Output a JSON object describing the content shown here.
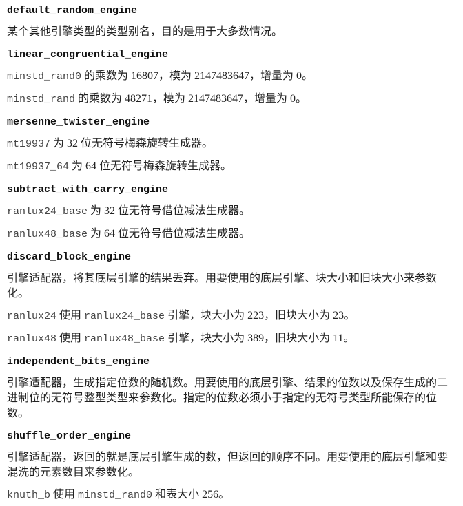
{
  "sections": [
    {
      "heading": "default_random_engine",
      "paragraphs": [
        [
          {
            "t": "某个其他引擎类型的类型别名，目的是用于大多数情况。"
          }
        ]
      ]
    },
    {
      "heading": "linear_congruential_engine",
      "paragraphs": [
        [
          {
            "t": "minstd_rand0",
            "mono": true
          },
          {
            "t": " 的乘数为 16807，模为 2147483647，增量为 0。"
          }
        ],
        [
          {
            "t": "minstd_rand",
            "mono": true
          },
          {
            "t": " 的乘数为 48271，模为 2147483647，增量为 0。"
          }
        ]
      ]
    },
    {
      "heading": "mersenne_twister_engine",
      "paragraphs": [
        [
          {
            "t": "mt19937",
            "mono": true
          },
          {
            "t": " 为 32 位无符号梅森旋转生成器。"
          }
        ],
        [
          {
            "t": "mt19937_64",
            "mono": true
          },
          {
            "t": " 为 64 位无符号梅森旋转生成器。"
          }
        ]
      ]
    },
    {
      "heading": "subtract_with_carry_engine",
      "paragraphs": [
        [
          {
            "t": "ranlux24_base",
            "mono": true
          },
          {
            "t": " 为 32 位无符号借位减法生成器。"
          }
        ],
        [
          {
            "t": "ranlux48_base",
            "mono": true
          },
          {
            "t": " 为 64 位无符号借位减法生成器。"
          }
        ]
      ]
    },
    {
      "heading": "discard_block_engine",
      "paragraphs": [
        [
          {
            "t": "引擎适配器，将其底层引擎的结果丢弃。用要使用的底层引擎、块大小和旧块大小来参数化。"
          }
        ],
        [
          {
            "t": "ranlux24",
            "mono": true
          },
          {
            "t": " 使用 "
          },
          {
            "t": "ranlux24_base",
            "mono": true
          },
          {
            "t": " 引擎，块大小为 223，旧块大小为 23。"
          }
        ],
        [
          {
            "t": "ranlux48",
            "mono": true
          },
          {
            "t": " 使用 "
          },
          {
            "t": "ranlux48_base",
            "mono": true
          },
          {
            "t": " 引擎，块大小为 389，旧块大小为 11。"
          }
        ]
      ]
    },
    {
      "heading": "independent_bits_engine",
      "paragraphs": [
        [
          {
            "t": "引擎适配器，生成指定位数的随机数。用要使用的底层引擎、结果的位数以及保存生成的二进制位的无符号整型类型来参数化。指定的位数必须小于指定的无符号类型所能保存的位数。"
          }
        ]
      ]
    },
    {
      "heading": "shuffle_order_engine",
      "paragraphs": [
        [
          {
            "t": "引擎适配器，返回的就是底层引擎生成的数，但返回的顺序不同。用要使用的底层引擎和要混洗的元素数目来参数化。"
          }
        ],
        [
          {
            "t": "knuth_b",
            "mono": true
          },
          {
            "t": " 使用 "
          },
          {
            "t": "minstd_rand0",
            "mono": true
          },
          {
            "t": " 和表大小 256。"
          }
        ]
      ]
    }
  ]
}
